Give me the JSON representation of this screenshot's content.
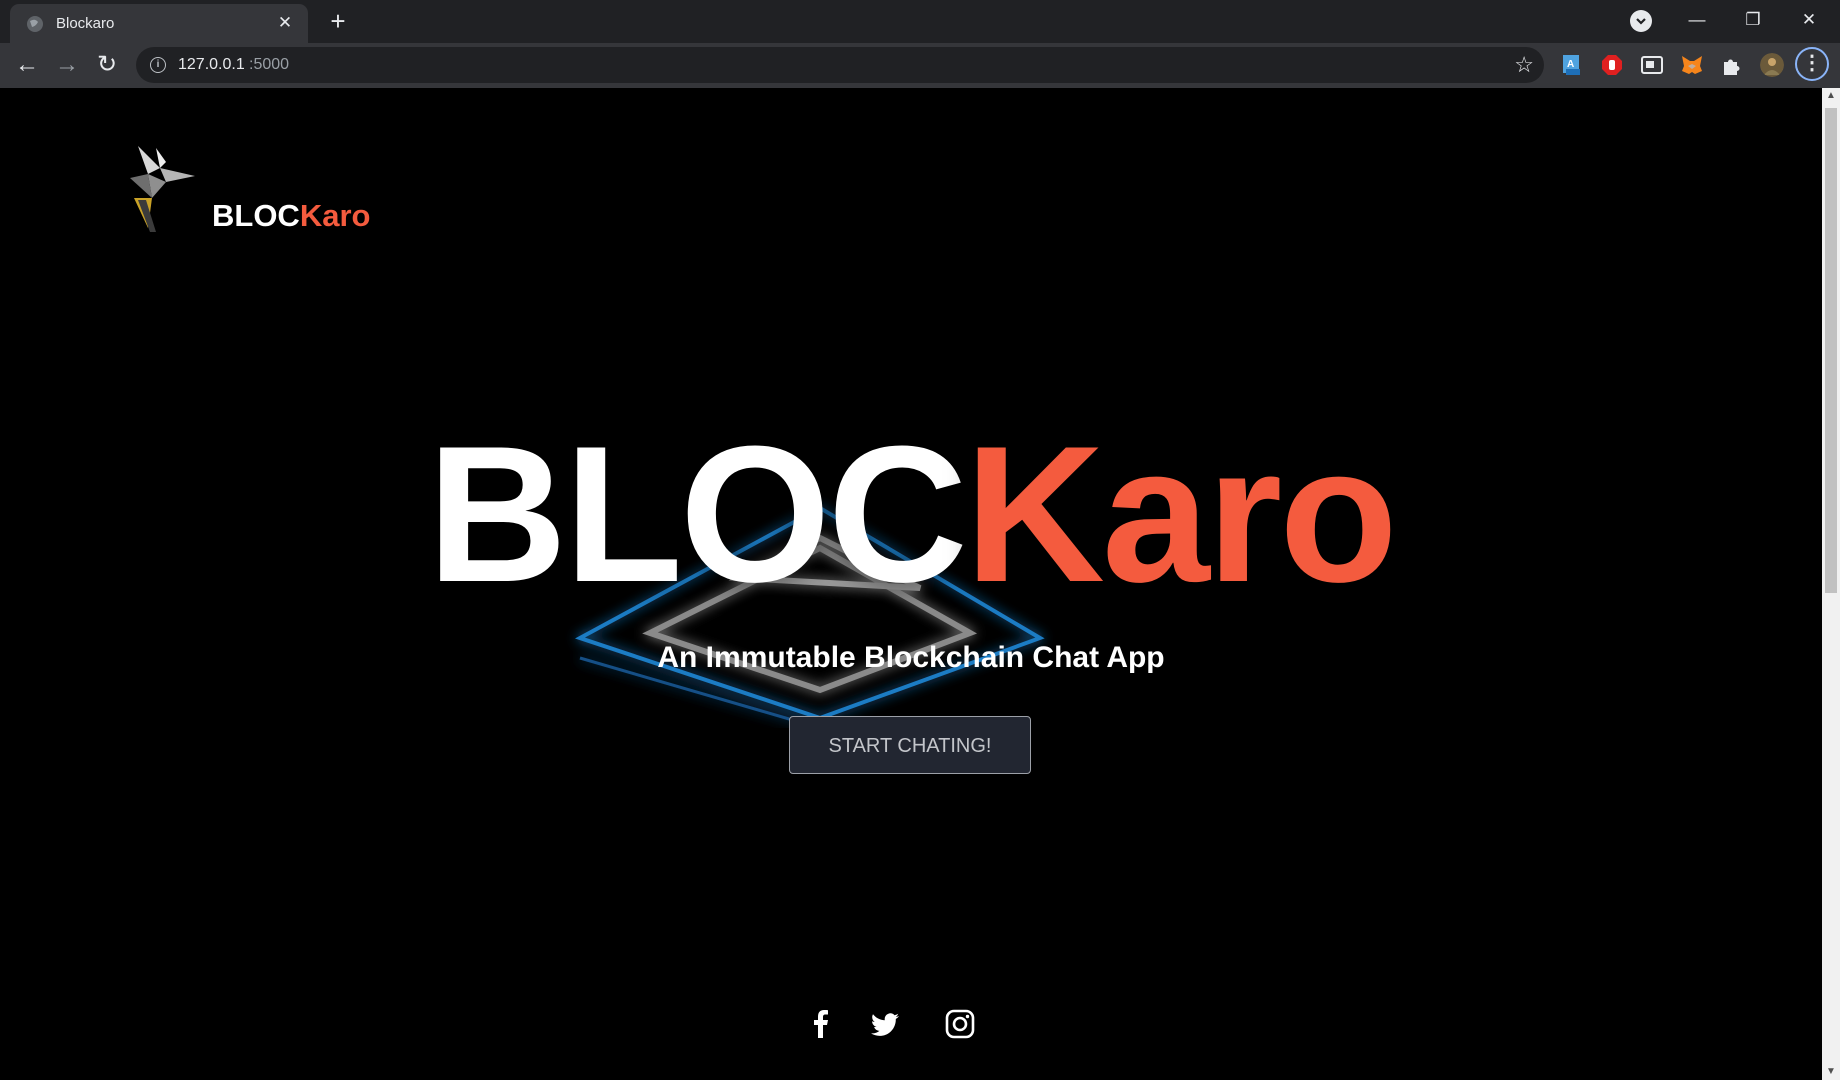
{
  "browser": {
    "tab_title": "Blockaro",
    "tab_close": "✕",
    "new_tab": "+",
    "url_host": "127.0.0.1",
    "url_port": ":5000",
    "minimize": "—",
    "restore": "❐",
    "close": "✕",
    "back": "←",
    "forward": "→",
    "reload": "↻",
    "star": "☆",
    "menu": "⋮"
  },
  "header": {
    "brand_part1": "BLOC",
    "brand_part2": "Karo"
  },
  "hero": {
    "title_part1": "BLOC",
    "title_part2": "Karo",
    "subtitle": "An Immutable Blockchain Chat App",
    "cta_label": "START CHATING!"
  },
  "social": [
    "facebook-icon",
    "twitter-icon",
    "instagram-icon"
  ],
  "colors": {
    "accent": "#f45b3e",
    "background": "#000000",
    "button_bg": "#222631"
  }
}
